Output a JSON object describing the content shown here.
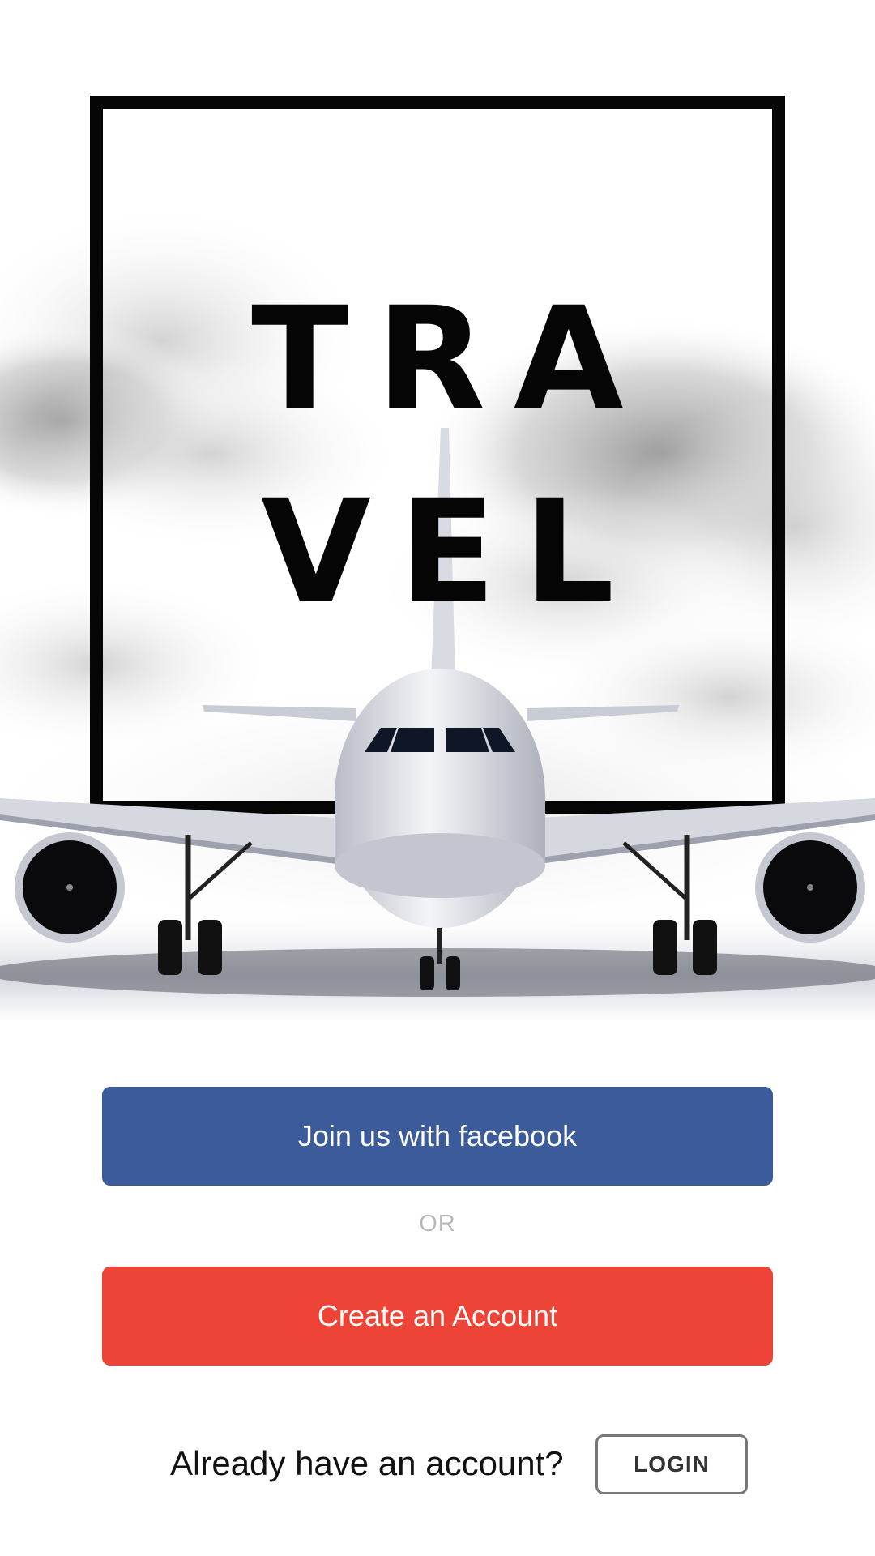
{
  "hero": {
    "title_line1": "TRA",
    "title_line2": "VEL"
  },
  "actions": {
    "facebook_label": "Join us with facebook",
    "or_label": "OR",
    "create_account_label": "Create an Account",
    "already_label": "Already have an account?",
    "login_label": "LOGIN"
  },
  "colors": {
    "facebook_blue": "#3b5b9a",
    "create_red": "#ee4437",
    "frame_black": "#050505"
  },
  "icons": [
    "airplane-illustration",
    "cloud-background"
  ]
}
